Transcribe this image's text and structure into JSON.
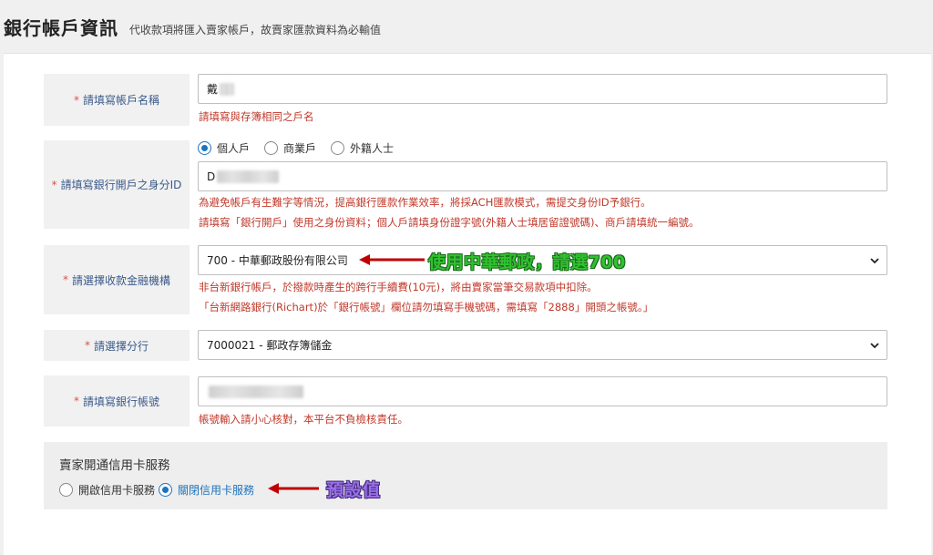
{
  "header": {
    "title": "銀行帳戶資訊",
    "subtitle": "代收款項將匯入賣家帳戶，故賣家匯款資料為必輸值"
  },
  "required_mark": "*",
  "account_name": {
    "label": "請填寫帳戶名稱",
    "value": "戴",
    "hint": "請填寫與存簿相同之戶名"
  },
  "identity": {
    "label": "請填寫銀行開戶之身分ID",
    "types": [
      {
        "label": "個人戶",
        "selected": true
      },
      {
        "label": "商業戶",
        "selected": false
      },
      {
        "label": "外籍人士",
        "selected": false
      }
    ],
    "value": "D",
    "hint_1": "為避免帳戶有生難字等情況，提高銀行匯款作業效率，將採ACH匯款模式，需提交身份ID予銀行。",
    "hint_2": "請填寫「銀行開戶」使用之身份資料；個人戶請填身份證字號(外籍人士填居留證號碼)、商戶請填統一編號。"
  },
  "bank": {
    "label": "請選擇收款金融機構",
    "value": "700 - 中華郵政股份有限公司",
    "hint_1": "非台新銀行帳戶，於撥款時產生的跨行手續費(10元)，將由賣家當筆交易款項中扣除。",
    "hint_2": "「台新網路銀行(Richart)於「銀行帳號」欄位請勿填寫手機號碼，需填寫「2888」開頭之帳號。」",
    "annotation": "使用中華郵政，請選700"
  },
  "branch": {
    "label": "請選擇分行",
    "value": "7000021 - 郵政存簿儲金"
  },
  "account_number": {
    "label": "請填寫銀行帳號",
    "value": "",
    "hint": "帳號輸入請小心核對，本平台不負檢核責任。"
  },
  "credit_card": {
    "title": "賣家開通信用卡服務",
    "options": [
      {
        "label": "開啟信用卡服務",
        "selected": false
      },
      {
        "label": "關閉信用卡服務",
        "selected": true
      }
    ],
    "annotation": "預設值"
  },
  "colors": {
    "label_text": "#3a5a8a",
    "required": "#d9534f",
    "hint": "#c0392b",
    "radio_on": "#1e73be",
    "arrow": "#c00000",
    "annotation_green": "#2fc22f",
    "annotation_purple": "#9b6fe8"
  },
  "icons": {
    "select_arrow": "chevron-down-icon",
    "annotation_arrow": "left-arrow-icon"
  }
}
